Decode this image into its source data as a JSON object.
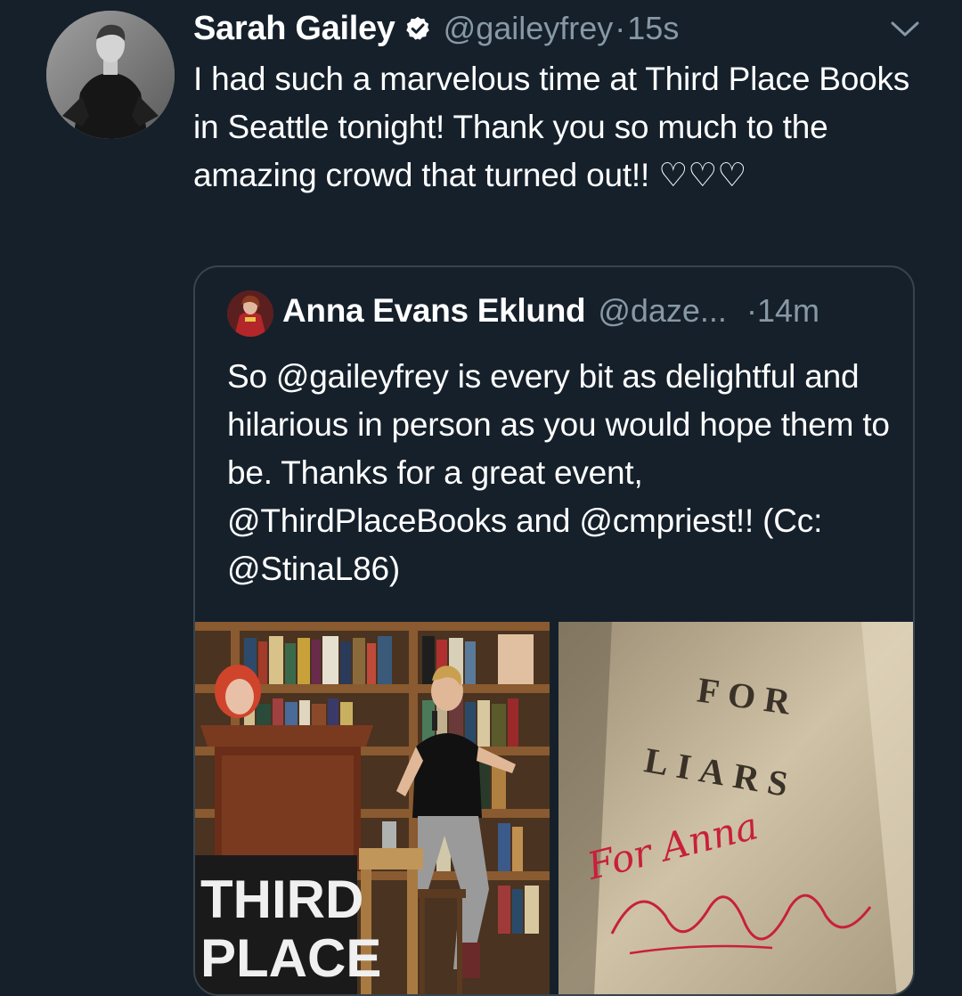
{
  "author": {
    "name": "Sarah Gailey",
    "handle": "@gaileyfrey",
    "separator": "·",
    "time": "15s",
    "verified": true
  },
  "tweet": {
    "text": "I had such a marvelous time at Third Place Books in Seattle tonight! Thank you so much to the amazing crowd that turned out!! ♡♡♡"
  },
  "quoted": {
    "name": "Anna Evans Eklund",
    "handle": "@daze...",
    "separator": "·",
    "time": "14m",
    "text": "So @gaileyfrey is every bit as delightful and hilarious in person as you would hope them to be. Thanks for a great event, @ThirdPlaceBooks and @cmpriest!! (Cc: @StinaL86)"
  },
  "media": {
    "left_photo": {
      "sign_line1": "THIRD",
      "sign_line2": "PLACE"
    },
    "right_photo": {
      "title_line1": "FOR",
      "title_line2": "LIARS",
      "inscription": "For Anna"
    }
  },
  "icons": {
    "verified": "verified-badge-icon",
    "menu": "chevron-down-icon"
  },
  "colors": {
    "background": "#15202b",
    "secondary_text": "#8899a6",
    "border": "#38444d",
    "verified_badge": "#ffffff"
  }
}
